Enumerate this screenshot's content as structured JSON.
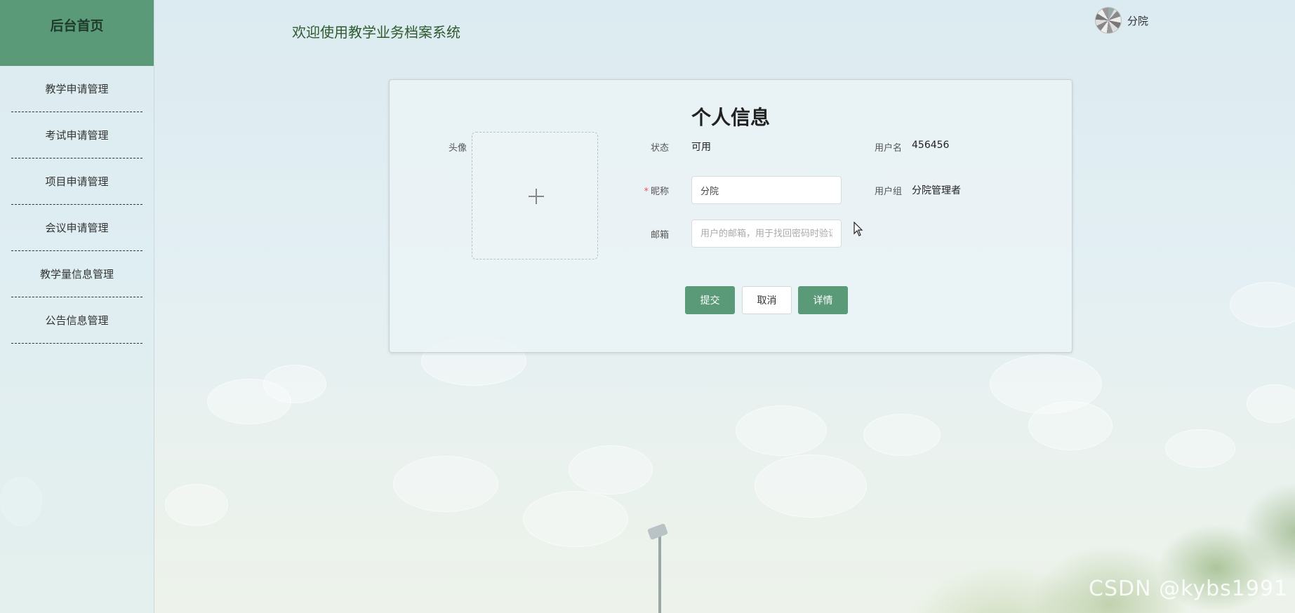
{
  "sidebar": {
    "home_label": "后台首页",
    "items": [
      {
        "label": "教学申请管理"
      },
      {
        "label": "考试申请管理"
      },
      {
        "label": "项目申请管理"
      },
      {
        "label": "会议申请管理"
      },
      {
        "label": "教学量信息管理"
      },
      {
        "label": "公告信息管理"
      }
    ]
  },
  "header": {
    "welcome_text": "欢迎使用教学业务档案系统",
    "user_name": "分院"
  },
  "profile": {
    "title": "个人信息",
    "avatar_label": "头像",
    "status_label": "状态",
    "status_value": "可用",
    "username_label": "用户名",
    "username_value": "456456",
    "nickname_label": "昵称",
    "nickname_value": "分院",
    "usergroup_label": "用户组",
    "usergroup_value": "分院管理者",
    "email_label": "邮箱",
    "email_placeholder": "用户的邮箱，用于找回密码时验证"
  },
  "actions": {
    "submit_label": "提交",
    "cancel_label": "取消",
    "details_label": "详情"
  },
  "watermark": "CSDN @kybs1991",
  "colors": {
    "accent": "#5a9a78",
    "required": "#e55555"
  }
}
